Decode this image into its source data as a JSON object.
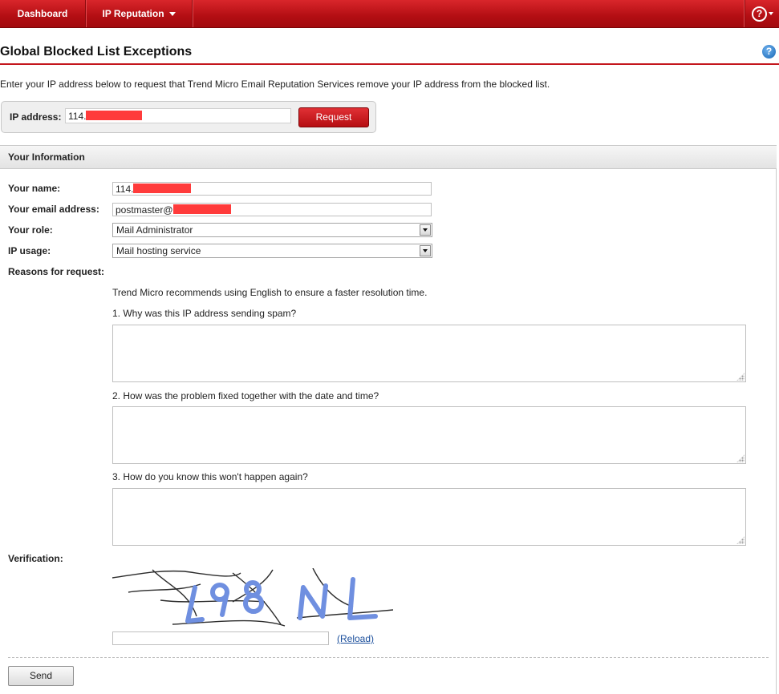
{
  "nav": {
    "dashboard": "Dashboard",
    "ip_reputation": "IP Reputation",
    "help_icon": "question-icon"
  },
  "page": {
    "title": "Global Blocked List Exceptions",
    "intro": "Enter your IP address below to request that Trend Micro Email Reputation Services remove your IP address from the blocked list."
  },
  "ip_form": {
    "label": "IP address:",
    "value_prefix": "114.",
    "request_label": "Request"
  },
  "section": {
    "title": "Your Information"
  },
  "form": {
    "name_label": "Your name:",
    "name_value_prefix": "114.",
    "email_label": "Your email address:",
    "email_value_prefix": "postmaster@",
    "role_label": "Your role:",
    "role_value": "Mail Administrator",
    "usage_label": "IP usage:",
    "usage_value": "Mail hosting service",
    "reasons_label": "Reasons for request:",
    "recommend_text": "Trend Micro recommends using English to ensure a faster resolution time.",
    "q1": "1. Why was this IP address sending spam?",
    "q2": "2. How was the problem fixed together with the date and time?",
    "q3": "3. How do you know this won't happen again?",
    "verification_label": "Verification:",
    "captcha_text": "L98 NL",
    "reload_label": "(Reload)",
    "send_label": "Send"
  },
  "colors": {
    "brand_red": "#c4161c",
    "redaction": "#ff3b3b",
    "captcha_blue": "#6f8fe0"
  }
}
